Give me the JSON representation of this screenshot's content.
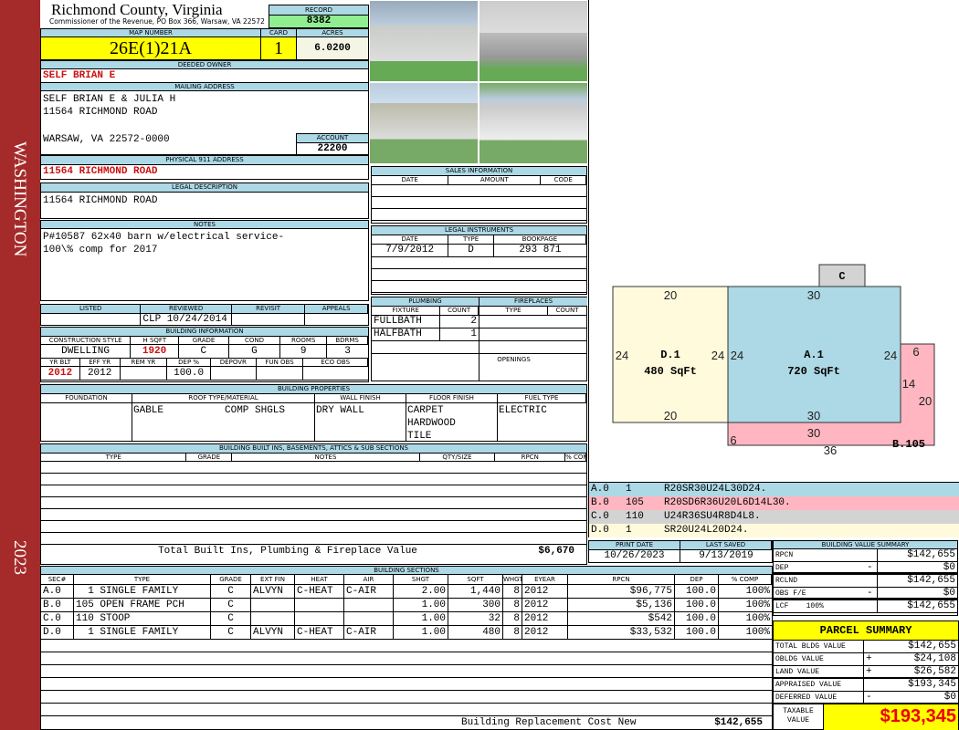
{
  "sidebar": {
    "district": "WASHINGTON",
    "year": "2023"
  },
  "header": {
    "title": "Richmond County, Virginia",
    "subtitle": "Commissioner of the Revenue, PO Box 366, Warsaw, VA 22572",
    "record_label": "RECORD",
    "record": "8382"
  },
  "parcel": {
    "map_label": "MAP NUMBER",
    "map": "26E(1)21A",
    "card_label": "CARD",
    "card": "1",
    "acres_label": "ACRES",
    "acres": "6.0200"
  },
  "owner": {
    "label": "DEEDED OWNER",
    "value": "SELF BRIAN E"
  },
  "mailing": {
    "label": "MAILING ADDRESS",
    "lines": [
      "SELF BRIAN E & JULIA H",
      "11564 RICHMOND ROAD",
      "",
      "WARSAW, VA 22572-0000"
    ],
    "account_label": "ACCOUNT",
    "account": "22200"
  },
  "physical": {
    "label": "PHYSICAL 911 ADDRESS",
    "value": "11564 RICHMOND ROAD"
  },
  "legal": {
    "label": "LEGAL DESCRIPTION",
    "value": "11564 RICHMOND ROAD"
  },
  "notes": {
    "label": "NOTES",
    "lines": [
      "P#10587 62x40 barn w/electrical service-",
      "100\\% comp for 2017"
    ]
  },
  "review": {
    "headers": [
      "LISTED",
      "REVIEWED",
      "REVISIT",
      "APPEALS"
    ],
    "values": [
      "",
      "CLP 10/24/2014",
      "",
      ""
    ]
  },
  "building_info": {
    "label": "BUILDING INFORMATION",
    "h1": [
      "CONSTRUCTION STYLE",
      "H SQFT",
      "GRADE",
      "COND",
      "ROOMS",
      "BDRMS"
    ],
    "v1": [
      "DWELLING",
      "1920",
      "C",
      "G",
      "9",
      "3"
    ],
    "h2": [
      "YR BLT",
      "EFF YR",
      "REM YR",
      "DEP %",
      "DEPOVR",
      "FUN OBS",
      "ECO OBS"
    ],
    "v2": [
      "2012",
      "2012",
      "",
      "100.0",
      "",
      "",
      ""
    ]
  },
  "sales": {
    "label": "SALES INFORMATION",
    "headers": [
      "DATE",
      "AMOUNT",
      "CODE"
    ]
  },
  "instruments": {
    "label": "LEGAL INSTRUMENTS",
    "headers": [
      "DATE",
      "TYPE",
      "BOOKPAGE"
    ],
    "rows": [
      [
        "7/9/2012",
        "D",
        "293 871"
      ]
    ]
  },
  "plumbing": {
    "label": "PLUMBING",
    "headers": [
      "FIXTURE",
      "COUNT"
    ],
    "rows": [
      [
        "FULLBATH",
        "2"
      ],
      [
        "HALFBATH",
        "1"
      ]
    ]
  },
  "fireplaces": {
    "label": "FIREPLACES",
    "headers": [
      "TYPE",
      "COUNT"
    ],
    "openings_label": "OPENINGS"
  },
  "properties": {
    "label": "BUILDING PROPERTIES",
    "headers": [
      "FOUNDATION",
      "ROOF TYPE/MATERIAL",
      "WALL FINISH",
      "FLOOR FINISH",
      "FUEL TYPE"
    ],
    "foundation": "",
    "roof_type": "GABLE",
    "roof_material": "COMP SHGLS",
    "wall": "DRY WALL",
    "floor": [
      "CARPET",
      "HARDWOOD",
      "TILE"
    ],
    "fuel": "ELECTRIC"
  },
  "builtins": {
    "label": "BUILDING BUILT INS, BASEMENTS, ATTICS & SUB SECTIONS",
    "headers": [
      "TYPE",
      "GRADE",
      "NOTES",
      "QTY/SIZE",
      "RPCN",
      "% COMP"
    ],
    "total_label": "Total Built Ins, Plumbing & Fireplace Value",
    "total": "$6,670"
  },
  "sections": {
    "label": "BUILDING SECTIONS",
    "headers": [
      "SEC#",
      "TYPE",
      "GRADE",
      "EXT FIN",
      "HEAT",
      "AIR",
      "SHGT",
      "SQFT",
      "WHGT",
      "EYEAR",
      "RPCN",
      "DEP",
      "% COMP"
    ],
    "rows": [
      [
        "A.0",
        "  1 SINGLE FAMILY",
        "C",
        "ALVYN",
        "C-HEAT",
        "C-AIR",
        "2.00",
        "1,440",
        "8",
        "2012",
        "$96,775",
        "100.0",
        "100%"
      ],
      [
        "B.0",
        "105 OPEN FRAME PCH",
        "C",
        "",
        "",
        "",
        "1.00",
        "300",
        "8",
        "2012",
        "$5,136",
        "100.0",
        "100%"
      ],
      [
        "C.0",
        "110 STOOP",
        "C",
        "",
        "",
        "",
        "1.00",
        "32",
        "8",
        "2012",
        "$542",
        "100.0",
        "100%"
      ],
      [
        "D.0",
        "  1 SINGLE FAMILY",
        "C",
        "ALVYN",
        "C-HEAT",
        "C-AIR",
        "1.00",
        "480",
        "8",
        "2012",
        "$33,532",
        "100.0",
        "100%"
      ]
    ],
    "total_label": "Building Replacement Cost New",
    "total": "$142,655"
  },
  "sketch": {
    "labels": {
      "c": "C",
      "a_name": "A.1",
      "a_area": "720 SqFt",
      "d_name": "D.1",
      "d_area": "480 SqFt",
      "b_name": "B.105"
    },
    "dims": {
      "d_top": "20",
      "d_bottom": "20",
      "d_left": "24",
      "d_right": "24",
      "a_top": "30",
      "a_bottom": "30",
      "a_left": "24",
      "a_right": "24",
      "b_top": "6",
      "b_mid": "14",
      "b_right": "20",
      "b_bottom1": "30",
      "b_bottom2": "36",
      "b_left": "6"
    },
    "legend": [
      {
        "sec": "A.0",
        "code": "1",
        "path": "R20SR30U24L30D24.",
        "color": "#add8e6"
      },
      {
        "sec": "B.0",
        "code": "105",
        "path": "R20SD6R36U20L6D14L30.",
        "color": "#ffb6c1"
      },
      {
        "sec": "C.0",
        "code": "110",
        "path": "U24R36SU4R8D4L8.",
        "color": "#d3d3d3"
      },
      {
        "sec": "D.0",
        "code": "1",
        "path": "SR20U24L20D24.",
        "color": "#fffadc"
      }
    ]
  },
  "dates": {
    "print_label": "PRINT DATE",
    "print": "10/26/2023",
    "saved_label": "LAST SAVED",
    "saved": "9/13/2019"
  },
  "bvs": {
    "label": "BUILDING VALUE SUMMARY",
    "rows": [
      [
        "RPCN",
        "",
        "$142,655"
      ],
      [
        "DEP",
        "-",
        "$0"
      ],
      [
        "RCLND",
        "",
        "$142,655"
      ],
      [
        "OBS F/E",
        "-",
        "$0"
      ],
      [
        "LCF    100%",
        "",
        "$142,655"
      ]
    ]
  },
  "parcel_summary": {
    "label": "PARCEL SUMMARY",
    "rows": [
      [
        "TOTAL BLDG VALUE",
        "",
        "$142,655"
      ],
      [
        "OBLDG VALUE",
        "+",
        "$24,108"
      ],
      [
        "LAND VALUE",
        "+",
        "$26,582"
      ],
      [
        "APPRAISED VALUE",
        "",
        "$193,345"
      ],
      [
        "DEFERRED VALUE",
        "-",
        "$0"
      ]
    ],
    "taxable_label": "TAXABLE VALUE",
    "taxable": "$193,345"
  }
}
